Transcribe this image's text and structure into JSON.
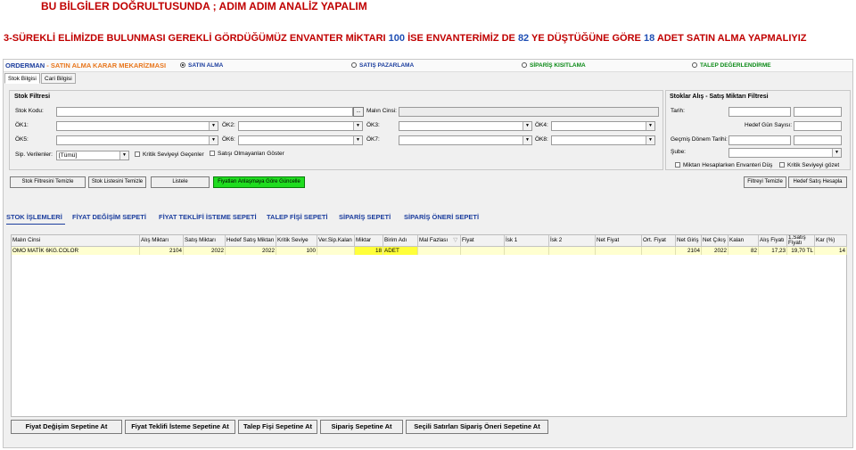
{
  "heading1": "BU BİLGİLER DOĞRULTUSUNDA ; ADIM ADIM ANALİZ YAPALIM",
  "heading2": {
    "p1": "3-SÜREKLİ ELİMİZDE BULUNMASI GEREKLİ GÖRDÜĞÜMÜZ ENVANTER MİKTARI ",
    "n1": "100",
    "p2": " İSE ENVANTERİMİZ DE ",
    "n2": "82",
    "p3": " YE DÜŞTÜĞÜNE GÖRE ",
    "n3": "18",
    "p4": " ADET SATIN ALMA YAPMALIYIZ"
  },
  "app": {
    "brand_a": "ORDERMAN",
    "brand_b": " - SATIN ALMA KARAR MEKARİZMASI",
    "radios": [
      {
        "label": "SATIN ALMA",
        "selected": true
      },
      {
        "label": "SATIŞ PAZARLAMA",
        "selected": false
      },
      {
        "label": "SİPARİŞ KISITLAMA",
        "selected": false
      },
      {
        "label": "TALEP DEĞERLENDİRME",
        "selected": false
      }
    ],
    "tabs": [
      "Stok Bilgisi",
      "Cari Bilgisi"
    ],
    "stock_filter": {
      "title": "Stok Filtresi",
      "stok_kodu": "Stok Kodu:",
      "malin_cinsi": "Malın Cinsi:",
      "ok1": "ÖK1:",
      "ok2": "ÖK2:",
      "ok3": "ÖK3:",
      "ok4": "ÖK4:",
      "ok5": "ÖK5:",
      "ok6": "ÖK6:",
      "ok7": "ÖK7:",
      "ok8": "ÖK8:",
      "sip_verilenler": "Sip. Verilenler:",
      "sip_value": "[Tümü]",
      "kritik_chk": "Kritik Seviyeyi Geçenler",
      "satis_chk": "Satışı Olmayanları Göster",
      "ellipsis": "..."
    },
    "sales_filter": {
      "title": "Stoklar Alış - Satış Miktarı Filtresi",
      "tarih": "Tarih:",
      "hedef_gun": "Hedef Gün Sayısı:",
      "gecmis": "Geçmiş Dönem Tarihi:",
      "sube": "Şube:",
      "miktari_chk": "Miktarı Hesaplarken Envanteri Düş",
      "kritik_chk": "Kritik Seviyeyi gözet"
    },
    "buttons": {
      "stok_filtre_temizle": "Stok Filtresini Temizle",
      "stok_listesi_temizle": "Stok Listesini Temizle",
      "listele": "Listele",
      "fiyat_guncelle": "Fiyatları Anlaşmaya Göre Güncelle",
      "filtreyi_temizle": "Filtreyi Temizle",
      "hedef_satis": "Hedef Satış Hesapla"
    },
    "subtabs": [
      "STOK İŞLEMLERİ",
      "FİYAT DEĞİŞİM SEPETİ",
      "FİYAT TEKLİFİ İSTEME SEPETİ",
      "TALEP FİŞİ SEPETİ",
      "SİPARİŞ SEPETİ",
      "SİPARİŞ ÖNERİ SEPETİ"
    ],
    "grid": {
      "columns": [
        "Malın Cinsi",
        "Alış Miktarı",
        "Satış Miktarı",
        "Hedef Satış Miktarı",
        "Kritik Seviye",
        "Ver.Sip.Kalan",
        "Miktar",
        "Birim Adı",
        "Mal Fazlası",
        "Fiyat",
        "İsk 1",
        "İsk 2",
        "Net Fiyat",
        "Ort. Fiyat",
        "Net Giriş",
        "Net Çıkış",
        "Kalan",
        "Alış Fiyatı",
        "1.Satış Fiyatı",
        "Kar (%)"
      ],
      "rows": [
        [
          "OMO MATİK 6KG.COLOR",
          "2104",
          "2022",
          "2022",
          "100",
          "",
          "18",
          "ADET",
          "",
          "",
          "",
          "",
          "",
          "",
          "2104",
          "2022",
          "82",
          "17,23",
          "19,70 TL",
          "14"
        ]
      ]
    },
    "bottom_buttons": [
      "Fiyat Değişim Sepetine At",
      "Fiyat Teklifi İsteme Sepetine At",
      "Talep Fişi Sepetine At",
      "Sipariş Sepetine At",
      "Seçili Satırları Sipariş Öneri Sepetine At"
    ]
  }
}
